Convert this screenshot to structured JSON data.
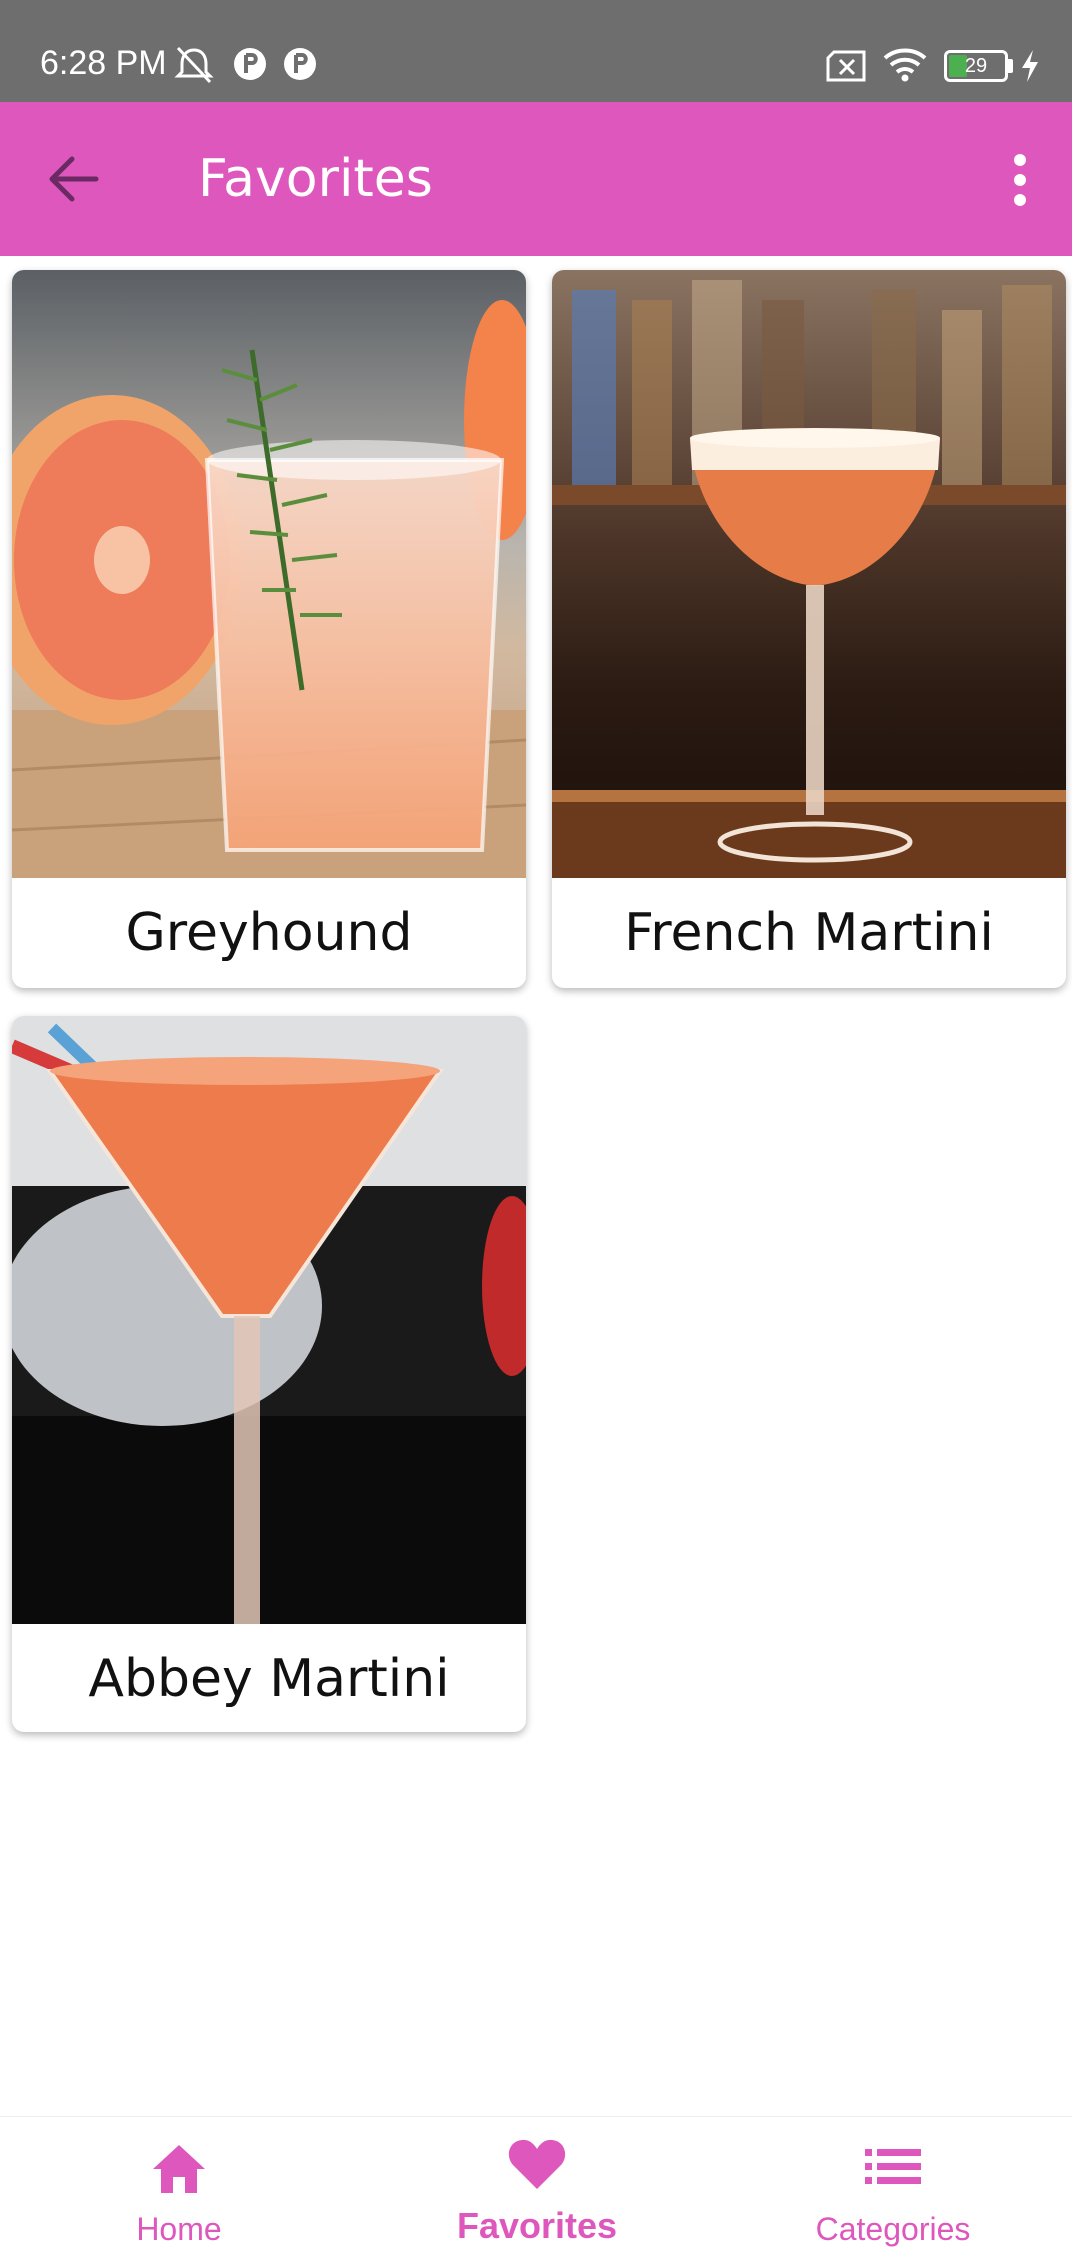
{
  "status_bar": {
    "time": "6:28 PM",
    "battery_level": "29",
    "icons": [
      "mute-alarm-icon",
      "app-notification-icon",
      "app-notification-icon",
      "sim-off-icon",
      "wifi-icon",
      "battery-icon",
      "charging-icon"
    ]
  },
  "app_bar": {
    "title": "Favorites",
    "back_icon": "arrow-left-icon",
    "menu_icon": "more-vert-icon",
    "background": "#de57bd"
  },
  "favorites": [
    {
      "name": "Greyhound"
    },
    {
      "name": "French Martini"
    },
    {
      "name": "Abbey Martini"
    }
  ],
  "bottom_nav": {
    "accent": "#de57bd",
    "items": [
      {
        "label": "Home",
        "icon": "home-icon",
        "active": false
      },
      {
        "label": "Favorites",
        "icon": "heart-icon",
        "active": true
      },
      {
        "label": "Categories",
        "icon": "list-icon",
        "active": false
      }
    ]
  }
}
